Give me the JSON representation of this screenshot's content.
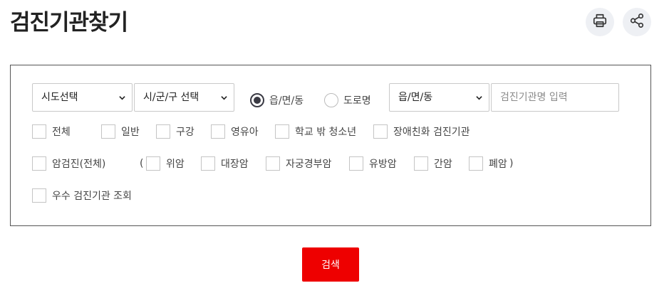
{
  "header": {
    "title": "검진기관찾기",
    "print_icon": "printer-icon",
    "share_icon": "share-icon"
  },
  "filters": {
    "sido_select": {
      "selected": "시도선택"
    },
    "sigungu_select": {
      "selected": "시/군/구 선택"
    },
    "address_type": {
      "options": [
        {
          "label": "읍/면/동",
          "checked": true
        },
        {
          "label": "도로명",
          "checked": false
        }
      ]
    },
    "dong_select": {
      "selected": "읍/면/동"
    },
    "name_input": {
      "placeholder": "검진기관명 입력",
      "value": ""
    }
  },
  "checkup_types": [
    {
      "label": "전체",
      "checked": false
    },
    {
      "label": "일반",
      "checked": false
    },
    {
      "label": "구강",
      "checked": false
    },
    {
      "label": "영유아",
      "checked": false
    },
    {
      "label": "학교 밖 청소년",
      "checked": false
    },
    {
      "label": "장애친화 검진기관",
      "checked": false
    }
  ],
  "cancer": {
    "all": {
      "label": "암검진(전체)",
      "checked": false
    },
    "open_paren": "(",
    "close_paren": ")",
    "types": [
      {
        "label": "위암",
        "checked": false
      },
      {
        "label": "대장암",
        "checked": false
      },
      {
        "label": "자궁경부암",
        "checked": false
      },
      {
        "label": "유방암",
        "checked": false
      },
      {
        "label": "간암",
        "checked": false
      },
      {
        "label": "폐암",
        "checked": false
      }
    ]
  },
  "excellent": {
    "label": "우수 검진기관 조회",
    "checked": false
  },
  "search_button": {
    "label": "검색"
  },
  "colors": {
    "accent": "#ee0000",
    "border": "#555555",
    "radio_checked": "#3a3a44"
  }
}
